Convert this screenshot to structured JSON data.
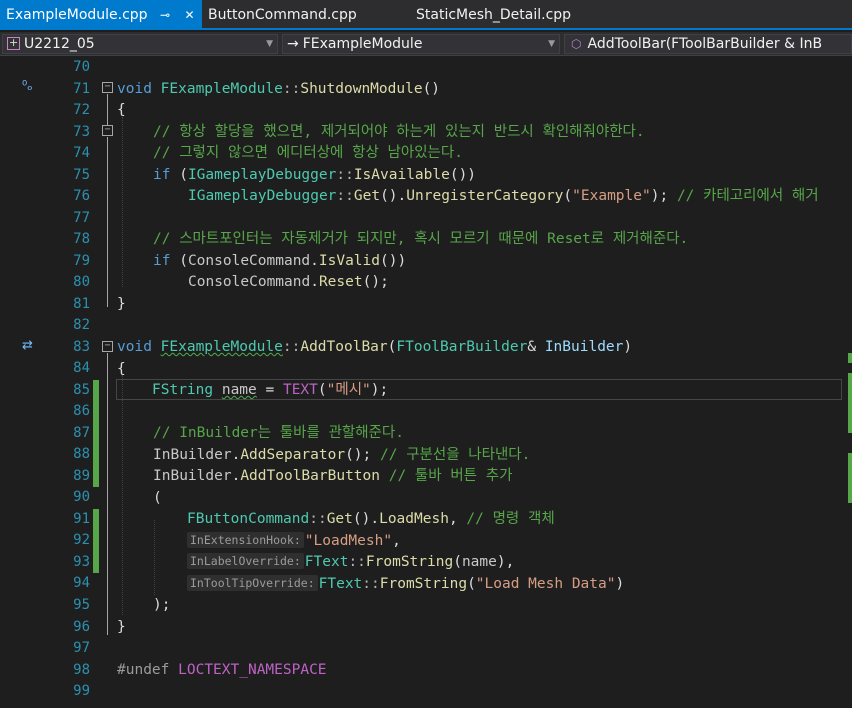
{
  "tabs": [
    {
      "label": "ExampleModule.cpp",
      "active": true
    },
    {
      "label": "ButtonCommand.cpp",
      "active": false
    },
    {
      "label": "StaticMesh_Detail.cpp",
      "active": false
    }
  ],
  "nav": {
    "project": "U2212_05",
    "scope": "FExampleModule",
    "member": "AddToolBar(FToolBarBuilder & InB"
  },
  "line_numbers": [
    "70",
    "71",
    "72",
    "73",
    "74",
    "75",
    "76",
    "77",
    "78",
    "79",
    "80",
    "81",
    "82",
    "83",
    "84",
    "85",
    "86",
    "87",
    "88",
    "89",
    "90",
    "91",
    "92",
    "93",
    "94",
    "95",
    "96",
    "97",
    "98",
    "99"
  ],
  "code": {
    "l71": {
      "kw": "void",
      "cls": "FExampleModule",
      "sep": "::",
      "fn": "ShutdownModule",
      "rest": "()"
    },
    "l72": "{",
    "l73": "// 항상 할당을 했으면, 제거되어야 하는게 있는지 반드시 확인해줘야한다.",
    "l74": "// 그렇지 않으면 에디터상에 항상 남아있는다.",
    "l75": {
      "kw": "if",
      "a": " (",
      "cls": "IGameplayDebugger",
      "sep": "::",
      "fn": "IsAvailable",
      "b": "())"
    },
    "l76": {
      "cls": "IGameplayDebugger",
      "sep": "::",
      "fn1": "Get",
      "a": "().",
      "fn2": "UnregisterCategory",
      "b": "(",
      "str": "\"Example\"",
      "c": "); ",
      "cm": "// 카테고리에서 해거"
    },
    "l78": "// 스마트포인터는 자동제거가 되지만, 혹시 모르기 때문에 Reset로 제거해준다.",
    "l79": {
      "kw": "if",
      "a": " (",
      "var": "ConsoleCommand",
      "b": ".",
      "fn": "IsValid",
      "c": "())"
    },
    "l80": {
      "var": "ConsoleCommand",
      "a": ".",
      "fn": "Reset",
      "b": "();"
    },
    "l81": "}",
    "l83": {
      "kw": "void",
      "cls": "FExampleModule",
      "sep": "::",
      "fn": "AddToolBar",
      "a": "(",
      "ty": "FToolBarBuilder",
      "b": "& ",
      "param": "InBuilder",
      "c": ")"
    },
    "l84": "{",
    "l85": {
      "ty": "FString",
      "a": " ",
      "var": "name",
      "b": " = ",
      "mac": "TEXT",
      "c": "(",
      "str": "\"메시\"",
      "d": ");"
    },
    "l87": "// InBuilder는 툴바를 관할해준다.",
    "l88": {
      "var": "InBuilder",
      "a": ".",
      "fn": "AddSeparator",
      "b": "(); ",
      "cm": "// 구분선을 나타낸다."
    },
    "l89": {
      "var": "InBuilder",
      "a": ".",
      "fn": "AddToolBarButton",
      "b": " ",
      "cm": "// 툴바 버튼 추가"
    },
    "l90": "(",
    "l91": {
      "cls": "FButtonCommand",
      "sep": "::",
      "fn1": "Get",
      "a": "().",
      "fn2": "LoadMesh",
      "b": ", ",
      "cm": "// 명령 객체"
    },
    "l92": {
      "hint": "InExtensionHook:",
      "str": "\"LoadMesh\"",
      "a": ","
    },
    "l93": {
      "hint": "InLabelOverride:",
      "ty": "FText",
      "sep": "::",
      "fn": "FromString",
      "a": "(",
      "var": "name",
      "b": "),"
    },
    "l94": {
      "hint": "InToolTipOverride:",
      "ty": "FText",
      "sep": "::",
      "fn": "FromString",
      "a": "(",
      "str": "\"Load Mesh Data\"",
      "b": ")"
    },
    "l95": ");",
    "l96": "}",
    "l98": {
      "pp": "#undef",
      "mac": "LOCTEXT_NAMESPACE"
    }
  },
  "colors": {
    "accent": "#007acc",
    "keyword": "#569cd6",
    "type": "#4ec9b0",
    "function": "#dcdcaa",
    "string": "#d69d85",
    "comment": "#57a64a",
    "line_number": "#2b91af",
    "change_bar": "#57a64a"
  },
  "icons": {
    "pin": "pin-icon",
    "close": "close-icon",
    "project": "project-icon",
    "scope": "arrow-right-icon",
    "member": "cube-icon",
    "breakpoint_hint": "codelens-icon",
    "overrides": "override-arrows-icon"
  }
}
